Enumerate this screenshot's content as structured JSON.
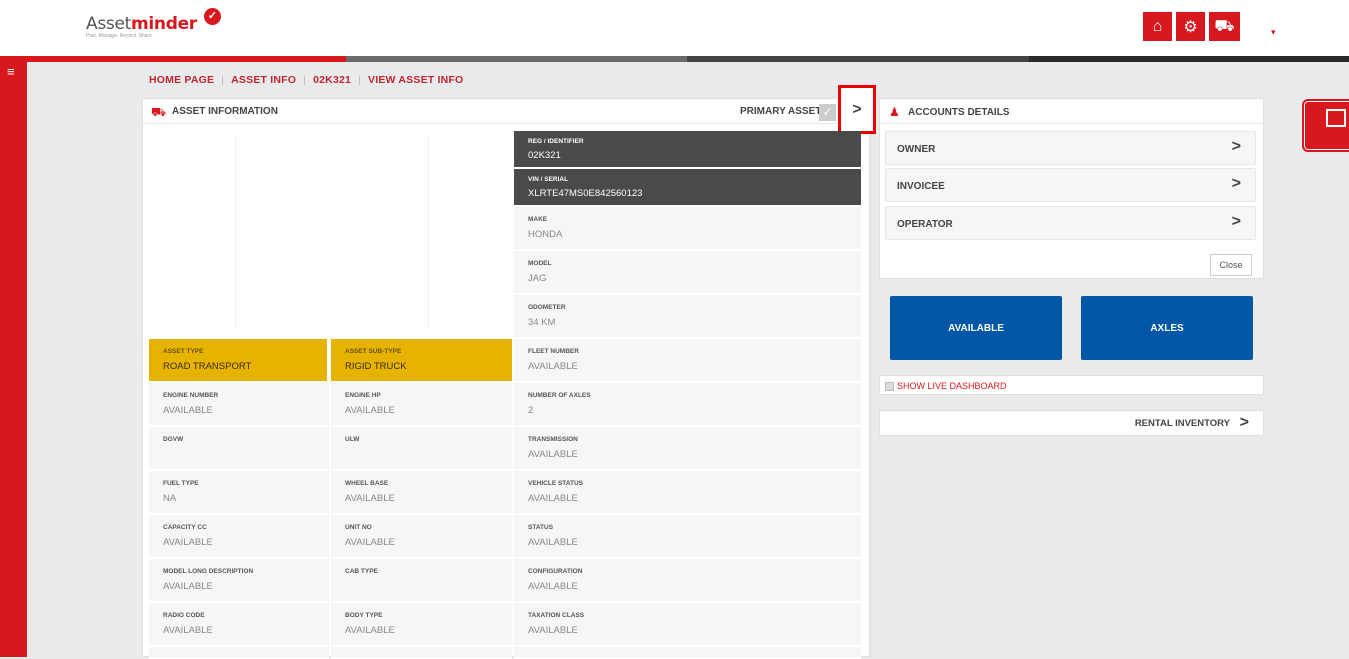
{
  "brand": {
    "name_plain": "Asset",
    "name_bold": "minder",
    "tagline": "Plan. Manage. Record. Share.",
    "accent": "#d7181f"
  },
  "header": {
    "icons": [
      "home-icon",
      "settings-icon",
      "truck-icon"
    ]
  },
  "breadcrumb": [
    "HOME PAGE",
    "ASSET INFO",
    "02K321",
    "VIEW ASSET INFO"
  ],
  "asset_panel": {
    "title": "ASSET INFORMATION",
    "primary_label": "PRIMARY ASSET",
    "id_fields": [
      {
        "label": "REG / IDENTIFIER",
        "value": "02K321"
      },
      {
        "label": "VIN / SERIAL",
        "value": "XLRTE47MS0E842560123"
      }
    ],
    "right_fields": [
      {
        "label": "MAKE",
        "value": "HONDA"
      },
      {
        "label": "MODEL",
        "value": "JAG"
      },
      {
        "label": "ODOMETER",
        "value": "34 KM"
      },
      {
        "label": "FLEET NUMBER",
        "value": "AVAILABLE"
      },
      {
        "label": "NUMBER OF AXLES",
        "value": "2"
      },
      {
        "label": "TRANSMISSION",
        "value": "AVAILABLE"
      },
      {
        "label": "VEHICLE STATUS",
        "value": "AVAILABLE"
      },
      {
        "label": "STATUS",
        "value": "AVAILABLE"
      },
      {
        "label": "CONFIGURATION",
        "value": "AVAILABLE"
      },
      {
        "label": "TAXATION CLASS",
        "value": "AVAILABLE"
      }
    ],
    "type_fields": [
      {
        "label": "ASSET TYPE",
        "value": "ROAD TRANSPORT"
      },
      {
        "label": "ASSET SUB-TYPE",
        "value": "RIGID TRUCK"
      }
    ],
    "left_fields": [
      {
        "label": "ENGINE NUMBER",
        "value": "AVAILABLE"
      },
      {
        "label": "DGVW",
        "value": ""
      },
      {
        "label": "FUEL TYPE",
        "value": "NA"
      },
      {
        "label": "CAPACITY CC",
        "value": "AVAILABLE"
      },
      {
        "label": "MODEL LONG DESCRIPTION",
        "value": "AVAILABLE"
      },
      {
        "label": "RADIO CODE",
        "value": "AVAILABLE"
      }
    ],
    "mid_fields": [
      {
        "label": "ENGINE HP",
        "value": "AVAILABLE"
      },
      {
        "label": "ULW",
        "value": ""
      },
      {
        "label": "WHEEL BASE",
        "value": "AVAILABLE"
      },
      {
        "label": "UNIT NO",
        "value": "AVAILABLE"
      },
      {
        "label": "CAB TYPE",
        "value": ""
      },
      {
        "label": "BODY TYPE",
        "value": "AVAILABLE"
      }
    ]
  },
  "accounts": {
    "title": "ACCOUNTS DETAILS",
    "items": [
      "OWNER",
      "INVOICEE",
      "OPERATOR"
    ],
    "close_label": "Close"
  },
  "buttons": {
    "available": "AVAILABLE",
    "axles": "AXLES"
  },
  "live_dashboard_label": "SHOW LIVE DASHBOARD",
  "rental_inventory_label": "RENTAL INVENTORY"
}
